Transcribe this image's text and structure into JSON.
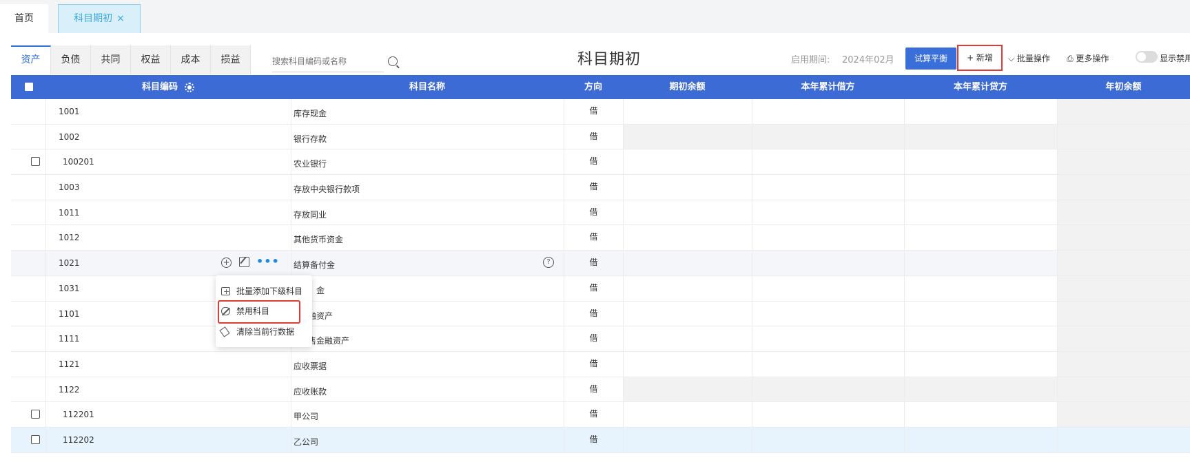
{
  "tabs": {
    "home": "首页",
    "active": "科目期初",
    "close": "×"
  },
  "categories": [
    "资产",
    "负债",
    "共同",
    "权益",
    "成本",
    "损益"
  ],
  "search": {
    "placeholder": "搜索科目编码或名称"
  },
  "title": "科目期初",
  "period": {
    "label": "启用期间:",
    "value": "2024年02月"
  },
  "buttons": {
    "trial_balance": "试算平衡",
    "add": "+ 新增",
    "batch": "批量操作",
    "more": "更多操作",
    "show_disabled": "显示禁用"
  },
  "columns": {
    "code": "科目编码",
    "name": "科目名称",
    "direction": "方向",
    "opening": "期初余额",
    "ytd_debit": "本年累计借方",
    "ytd_credit": "本年累计贷方",
    "year_begin": "年初余额"
  },
  "rows": [
    {
      "code": "1001",
      "name": "库存现金",
      "dir": "借"
    },
    {
      "code": "1002",
      "name": "银行存款",
      "dir": "借"
    },
    {
      "code": "100201",
      "name": "农业银行",
      "dir": "借"
    },
    {
      "code": "1003",
      "name": "存放中央银行款项",
      "dir": "借"
    },
    {
      "code": "1011",
      "name": "存放同业",
      "dir": "借"
    },
    {
      "code": "1012",
      "name": "其他货币资金",
      "dir": "借"
    },
    {
      "code": "1021",
      "name": "结算备付金",
      "dir": "借"
    },
    {
      "code": "1031",
      "name": "金",
      "dir": "借"
    },
    {
      "code": "1101",
      "name": "融资产",
      "dir": "借"
    },
    {
      "code": "1111",
      "name": "售金融资产",
      "dir": "借"
    },
    {
      "code": "1121",
      "name": "应收票据",
      "dir": "借"
    },
    {
      "code": "1122",
      "name": "应收账款",
      "dir": "借"
    },
    {
      "code": "112201",
      "name": "甲公司",
      "dir": "借"
    },
    {
      "code": "112202",
      "name": "乙公司",
      "dir": "借"
    }
  ],
  "menu": {
    "batch_add": "批量添加下级科目",
    "disable": "禁用科目",
    "clear": "清除当前行数据"
  },
  "help": "?",
  "more_dots": "•••"
}
